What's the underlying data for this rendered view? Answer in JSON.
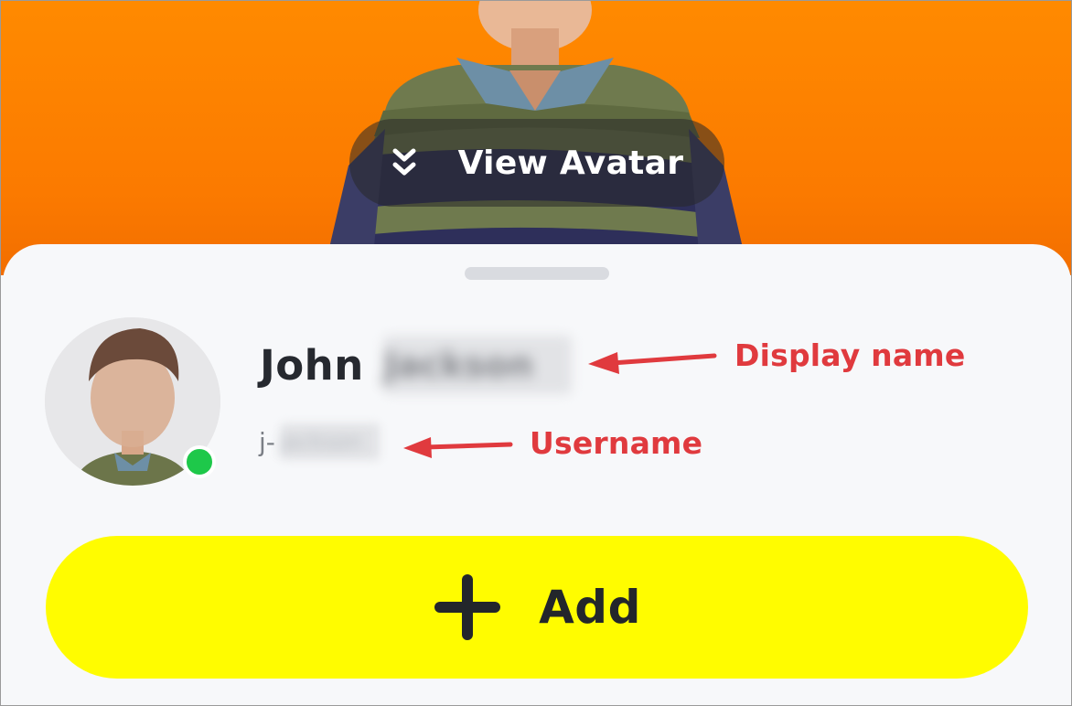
{
  "header": {
    "view_avatar_label": "View Avatar",
    "view_avatar_icon": "double-chevron-down-icon"
  },
  "profile": {
    "display_name_first": "John",
    "display_name_last": "Jackson",
    "username_prefix": "j-",
    "username_rest": "jackson",
    "online": true,
    "online_color": "#1ec84a"
  },
  "annotations": {
    "display_name_label": "Display name",
    "username_label": "Username",
    "color": "#e03a3e"
  },
  "actions": {
    "add_label": "Add",
    "add_icon": "plus-icon",
    "add_color": "#fffc00"
  },
  "colors": {
    "hero_background": "#ff8a00",
    "sheet_background": "#f7f8fa"
  }
}
